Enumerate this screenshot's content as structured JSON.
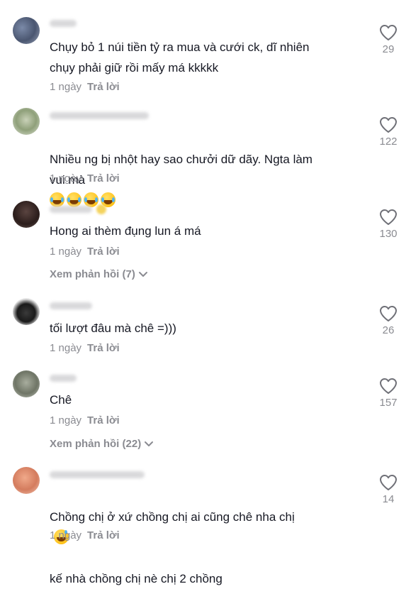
{
  "comments": [
    {
      "text": "Chụy bỏ 1 núi tiền tỷ ra mua và cưới ck, dĩ nhiên\nchụy phải giữ rồi mấy má kkkkk",
      "time": "1 ngày",
      "reply_label": "Trả lời",
      "likes": "29"
    },
    {
      "text": "Nhiều ng bị nhột hay sao chưởi dữ dãy. Ngta làm\nvui mà",
      "emojis": [
        "laughing-tears",
        "laughing-tears",
        "laughing-tears",
        "laughing-tears"
      ],
      "time": "1 ngày",
      "reply_label": "Trả lời",
      "likes": "122"
    },
    {
      "text": "Hong ai thèm đụng lun á má",
      "time": "1 ngày",
      "reply_label": "Trả lời",
      "view_replies": "Xem phản hồi (7)",
      "likes": "130"
    },
    {
      "text": "tối lượt đâu mà chê =)))",
      "time": "1 ngày",
      "reply_label": "Trả lời",
      "likes": "26"
    },
    {
      "text": "Chê",
      "time": "1 ngày",
      "reply_label": "Trả lời",
      "view_replies": "Xem phản hồi (22)",
      "likes": "157"
    },
    {
      "text": "Chồng chị ở xứ chồng chị ai cũng chê nha chị",
      "text_line2": "kế nhà chồng chị nè chị 2 chồng",
      "emojis": [
        "grinning-sweat"
      ],
      "time": "1 ngày",
      "reply_label": "Trả lời",
      "likes": "14"
    }
  ],
  "icons": {
    "like": "heart-outline-icon",
    "expand": "chevron-down-icon",
    "emoji_laugh": "laughing-tears-emoji",
    "emoji_sweat": "grinning-sweat-emoji"
  },
  "colors": {
    "text": "#161823",
    "meta": "#8a8b91",
    "background": "#ffffff"
  }
}
